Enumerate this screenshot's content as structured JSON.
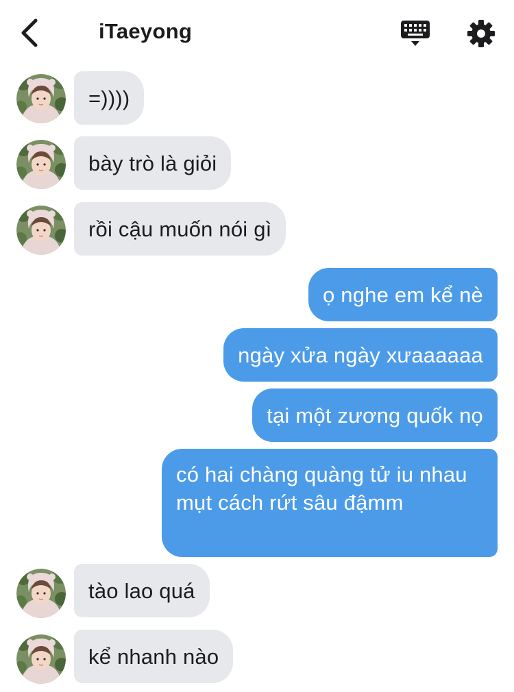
{
  "header": {
    "title": "iTaeyong",
    "back_icon": "chevron-left-icon",
    "keyboard_icon": "keyboard-icon",
    "settings_icon": "gear-icon"
  },
  "colors": {
    "incoming_bubble": "#e6e8ec",
    "outgoing_bubble": "#4c9be9",
    "text_dark": "#1c1c1e",
    "text_light": "#ffffff"
  },
  "messages": [
    {
      "direction": "incoming",
      "text": "=))))"
    },
    {
      "direction": "incoming",
      "text": "bày trò là giỏi"
    },
    {
      "direction": "incoming",
      "text": "rồi cậu muốn nói gì"
    },
    {
      "direction": "outgoing",
      "text": "ọ nghe em kể nè"
    },
    {
      "direction": "outgoing",
      "text": "ngày xửa ngày xưaaaaaa"
    },
    {
      "direction": "outgoing",
      "text": "tại một zương quốk nọ"
    },
    {
      "direction": "outgoing",
      "text": "có hai chàng quàng tử iu nhau mụt cách rứt sâu đậmm"
    },
    {
      "direction": "incoming",
      "text": "tào lao quá"
    },
    {
      "direction": "incoming",
      "text": "kể nhanh nào"
    }
  ]
}
